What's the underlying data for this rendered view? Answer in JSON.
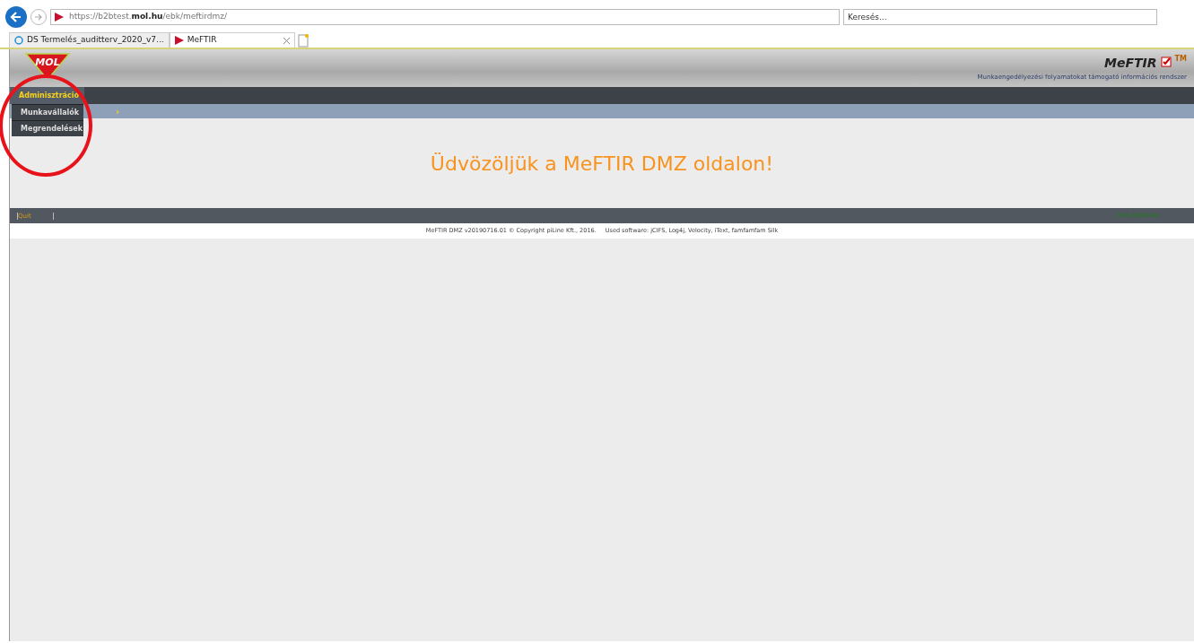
{
  "browser": {
    "url_prefix": "https://b2btest.",
    "url_domain": "mol.hu",
    "url_path": "/ebk/meftirdmz/",
    "search": {
      "placeholder": "Keresés..."
    },
    "tabs": [
      {
        "label": "DS Termelés_auditterv_2020_v7...",
        "selected": false,
        "closable": false
      },
      {
        "label": "MeFTIR",
        "selected": true,
        "closable": true
      }
    ]
  },
  "header": {
    "logo": "MOL",
    "product": "MeFTIR",
    "trademark": "TM",
    "subtitle": "Munkaengedélyezési folyamatokat támogató információs rendszer"
  },
  "menu": [
    {
      "label": "Adminisztráció",
      "expanded": true,
      "children": [
        {
          "label": "Munkavállalók"
        },
        {
          "label": "Megrendelések"
        }
      ]
    }
  ],
  "submenu_arrow": "›",
  "welcome": "Üdvözöljük a MeFTIR DMZ oldalon!",
  "footer": {
    "links": [
      "Quit"
    ],
    "database": "Test database",
    "copyright": "MeFTIR DMZ v20190716.01 © Copyright piLine Kft., 2016.",
    "software": "Used software: jCIFS, Log4j, Velocity, iText, famfamfam Silk"
  }
}
